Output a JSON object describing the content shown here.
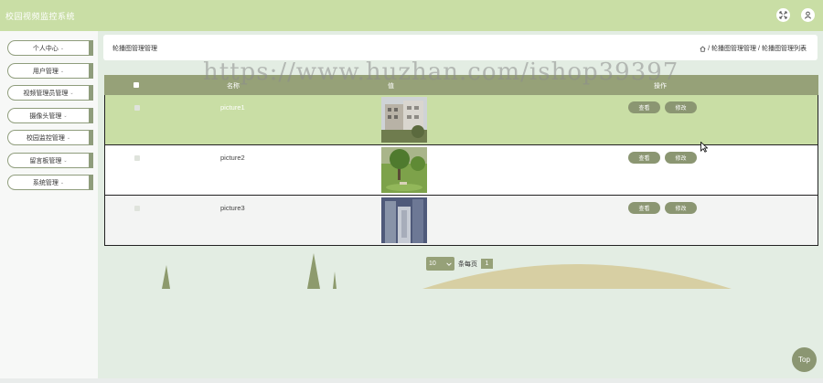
{
  "app": {
    "title": "校园视频监控系统"
  },
  "header": {
    "fullscreen_icon": "fullscreen-icon",
    "user_icon": "user-icon"
  },
  "sidebar": {
    "items": [
      {
        "label": "个人中心",
        "chevron": "⌄"
      },
      {
        "label": "用户管理",
        "chevron": "⌄"
      },
      {
        "label": "视频管理员管理",
        "chevron": "⌄"
      },
      {
        "label": "摄像头管理",
        "chevron": "⌄"
      },
      {
        "label": "校园监控管理",
        "chevron": "⌄"
      },
      {
        "label": "留言板管理",
        "chevron": "⌄"
      },
      {
        "label": "系统管理",
        "chevron": "⌄"
      }
    ]
  },
  "page": {
    "title": "轮播图管理管理",
    "breadcrumb": [
      "轮播图管理管理",
      "轮播图管理列表"
    ],
    "breadcrumb_sep": "/"
  },
  "table": {
    "columns": {
      "name": "名称",
      "image": "值",
      "actions": "操作"
    },
    "rows": [
      {
        "name": "picture1",
        "view": "查看",
        "edit": "修改",
        "highlight": true
      },
      {
        "name": "picture2",
        "view": "查看",
        "edit": "修改",
        "highlight": false
      },
      {
        "name": "picture3",
        "view": "查看",
        "edit": "修改",
        "highlight": false
      }
    ]
  },
  "pagination": {
    "page_size": "10",
    "per_page_label": "条每页",
    "current_page": "1"
  },
  "watermark": "https://www.huzhan.com/ishop39397",
  "top_button": "Top",
  "colors": {
    "header": "#c9dea5",
    "accent": "#96a178",
    "button": "#8b9672",
    "row_highlight": "#c9dea5",
    "background": "#e3ede3"
  }
}
